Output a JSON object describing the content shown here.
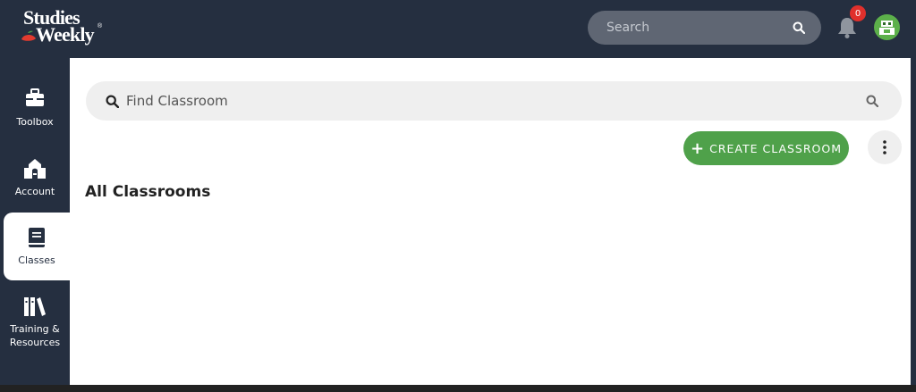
{
  "brand": {
    "line1": "Studies",
    "line2": "Weekly",
    "reg": "®"
  },
  "header": {
    "search": {
      "placeholder": "Search",
      "icon": "search-icon"
    },
    "notifications": {
      "icon": "bell-icon",
      "count": "0",
      "badge_color": "#e0302c"
    },
    "avatar": {
      "icon": "user-avatar-icon",
      "color": "#5cb04a"
    }
  },
  "sidebar": {
    "items": [
      {
        "label": "Toolbox",
        "icon": "toolbox-icon",
        "active": false
      },
      {
        "label": "Account",
        "icon": "school-building-icon",
        "active": false
      },
      {
        "label": "Classes",
        "icon": "book-icon",
        "active": true
      },
      {
        "label_line1": "Training &",
        "label_line2": "Resources",
        "icon": "library-books-icon",
        "active": false
      }
    ]
  },
  "main": {
    "find": {
      "placeholder": "Find Classroom",
      "icon": "search-icon"
    },
    "create_button": {
      "plus": "+",
      "label": "CREATE CLASSROOM",
      "color": "#4fa14a"
    },
    "more_button": {
      "icon": "more-vertical-icon"
    },
    "section_title": "All Classrooms"
  },
  "colors": {
    "chrome": "#252f40",
    "panel": "#ffffff",
    "search_bg": "#efefef"
  }
}
